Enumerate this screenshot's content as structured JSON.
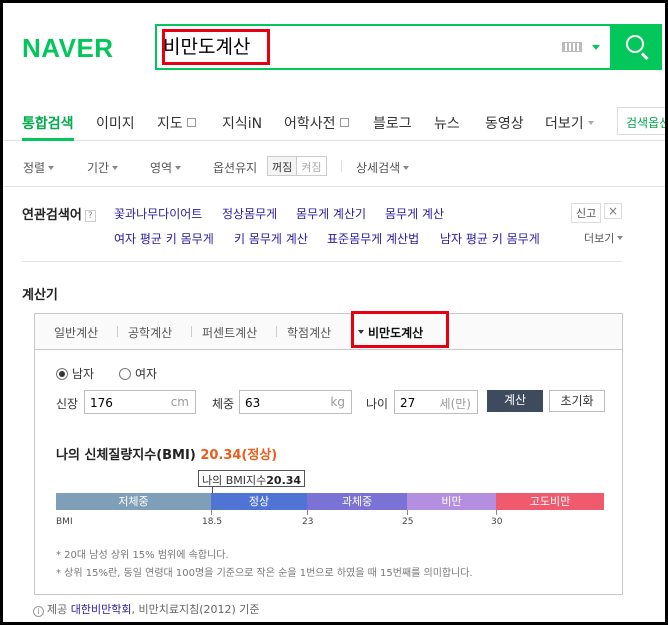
{
  "header": {
    "logo": "NAVER",
    "query": "비만도계산",
    "search_button": "search"
  },
  "nav": {
    "tabs": [
      {
        "label": "통합검색"
      },
      {
        "label": "이미지"
      },
      {
        "label": "지도"
      },
      {
        "label": "지식iN"
      },
      {
        "label": "어학사전"
      },
      {
        "label": "블로그"
      },
      {
        "label": "뉴스"
      },
      {
        "label": "동영상"
      },
      {
        "label": "더보기"
      }
    ],
    "options_button": "검색옵션"
  },
  "filters": {
    "items": [
      "정렬",
      "기간",
      "영역",
      "옵션유지",
      "상세검색"
    ],
    "toggle_on": "꺼짐",
    "toggle_off": "켜짐"
  },
  "related": {
    "title": "연관검색어",
    "help": "?",
    "report": "신고",
    "close": "×",
    "more": "더보기",
    "links": [
      "꽃과나무다이어트",
      "정상몸무게",
      "몸무게 계산기",
      "몸무게 계산",
      "여자 평균 키 몸무게",
      "키 몸무게 계산",
      "표준몸무게 계산법",
      "남자 평균 키 몸무게"
    ]
  },
  "calculator": {
    "title": "계산기",
    "tabs": [
      "일반계산",
      "공학계산",
      "퍼센트계산",
      "학점계산",
      "비만도계산"
    ],
    "gender": {
      "male": "남자",
      "female": "여자",
      "selected": "male"
    },
    "height": {
      "label": "신장",
      "value": "176",
      "unit": "cm"
    },
    "weight": {
      "label": "체중",
      "value": "63",
      "unit": "kg"
    },
    "age": {
      "label": "나이",
      "value": "27",
      "unit": "세(만)"
    },
    "calc_button": "계산",
    "reset_button": "초기화",
    "result_label": "나의 신체질량지수(BMI)",
    "result_value": "20.34(정상)",
    "marker_label": "나의 BMI지수",
    "marker_value": "20.34",
    "bmi_value": 20.34,
    "segments": [
      {
        "label": "저체중",
        "color": "#7f9fb8"
      },
      {
        "label": "정상",
        "color": "#4f74d4"
      },
      {
        "label": "과체중",
        "color": "#7a72d4"
      },
      {
        "label": "비만",
        "color": "#b48fe0"
      },
      {
        "label": "고도비만",
        "color": "#ef5a6c"
      }
    ],
    "scale_labels": [
      "BMI",
      "18.5",
      "23",
      "25",
      "30"
    ],
    "notes": [
      "* 20대 남성 상위 15% 범위에 속합니다.",
      "* 상위 15%란, 동일 연령대 100명을 기준으로 작은 순을 1번으로 하였을 때 15번째를 의미합니다."
    ],
    "source_prefix": "제공",
    "source_link": "대한비만학회",
    "source_suffix": ", 비만치료지침(2012) 기준"
  }
}
